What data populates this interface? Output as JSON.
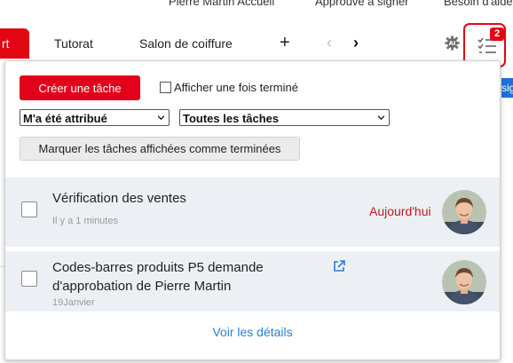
{
  "background_header": {
    "cutoff_text_1": "Pierre Martin Accueil",
    "cutoff_text_2": "Approuvé à signer",
    "cutoff_text_3": "Besoin d'aide"
  },
  "tabs": {
    "active_label": "rt",
    "items": [
      {
        "label": "Tutorat"
      },
      {
        "label": "Salon de coiffure"
      }
    ],
    "add_label": "+",
    "prev_label": "‹",
    "next_label": "›"
  },
  "toolbar": {
    "tasks_badge": "2",
    "right_edge_text": "sig"
  },
  "panel": {
    "create_button": "Créer une tâche",
    "show_done_label": "Afficher une fois terminé",
    "filter_assigned": {
      "selected": "M'a été attribué"
    },
    "filter_tasks": {
      "selected": "Toutes les tâches"
    },
    "mark_done_button": "Marquer les tâches affichées comme terminées",
    "tasks": [
      {
        "title": "Vérification des ventes",
        "meta": "Il y a 1 minutes",
        "due": "Aujourd'hui",
        "avatar": "user-avatar"
      },
      {
        "title_line_1": "Codes-barres produits P5 demande",
        "title_line_2": "d'approbation de Pierre Martin",
        "meta": "19Janvier",
        "has_external_link": true,
        "avatar": "user-avatar"
      }
    ],
    "details_link": "Voir les détails"
  },
  "colors": {
    "accent_red": "#e30613",
    "link_blue": "#2b7fd8",
    "task_bg": "#ecf0f4"
  }
}
